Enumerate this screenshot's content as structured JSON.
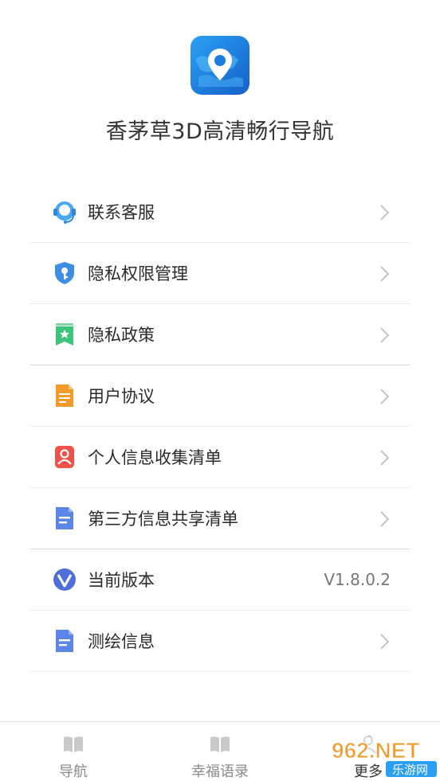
{
  "app": {
    "title": "香茅草3D高清畅行导航",
    "logo_icon": "map-pin-globe-icon"
  },
  "menu": {
    "items": [
      {
        "label": "联系客服",
        "icon": "customer-service-icon"
      },
      {
        "label": "隐私权限管理",
        "icon": "shield-key-icon"
      },
      {
        "label": "隐私政策",
        "icon": "bookmark-star-icon"
      },
      {
        "label": "用户协议",
        "icon": "document-orange-icon"
      },
      {
        "label": "个人信息收集清单",
        "icon": "user-card-icon"
      },
      {
        "label": "第三方信息共享清单",
        "icon": "document-blue-icon"
      },
      {
        "label": "当前版本",
        "icon": "version-v-icon",
        "value": "V1.8.0.2"
      },
      {
        "label": "测绘信息",
        "icon": "document-blue-icon"
      }
    ]
  },
  "tabbar": {
    "tabs": [
      {
        "label": "导航",
        "icon": "book-icon"
      },
      {
        "label": "幸福语录",
        "icon": "book-icon"
      },
      {
        "label": "更多",
        "icon": "person-icon"
      }
    ]
  },
  "watermark": {
    "brand": "962.NET",
    "sub": "乐游网"
  },
  "colors": {
    "chevron": "#c4c4c4",
    "divider": "#ececec",
    "logo_blue": "#1e7de0",
    "tab_inactive": "#8a8a8a"
  }
}
